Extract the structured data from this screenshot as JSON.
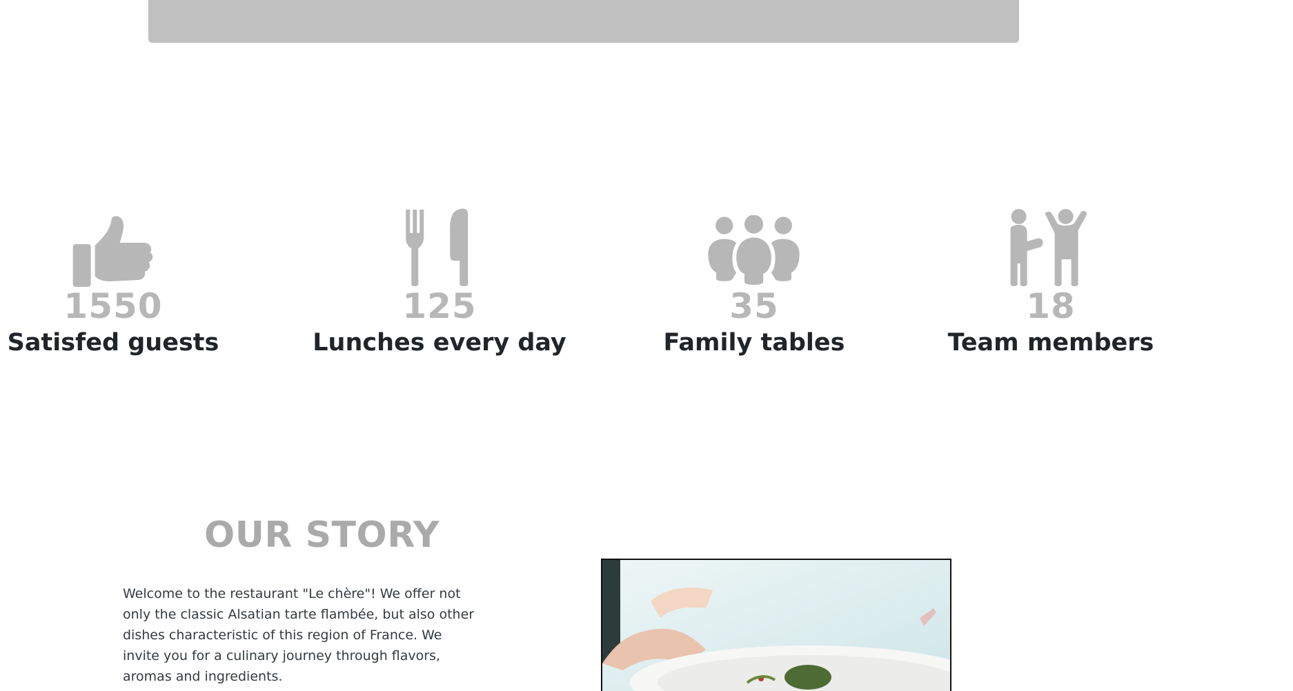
{
  "stats": [
    {
      "icon": "thumbs-up-icon",
      "count": "1550",
      "label": "Satisfed guests"
    },
    {
      "icon": "fork-knife-icon",
      "count": "125",
      "label": "Lunches every day"
    },
    {
      "icon": "family-icon",
      "count": "35",
      "label": "Family tables"
    },
    {
      "icon": "team-people-icon",
      "count": "18",
      "label": "Team members"
    }
  ],
  "story": {
    "title": "OUR STORY",
    "text": "Welcome to the restaurant \"Le chère\"! We offer not only the classic Alsatian tarte flambée, but also other dishes characteristic of this region of France. We invite you for a culinary journey through flavors, aromas and ingredients."
  },
  "colors": {
    "banner": "#c0c0c0",
    "icon": "#b7b7b7",
    "count": "#b7b7b7",
    "heading": "#aaaaaa",
    "text": "#212529"
  }
}
